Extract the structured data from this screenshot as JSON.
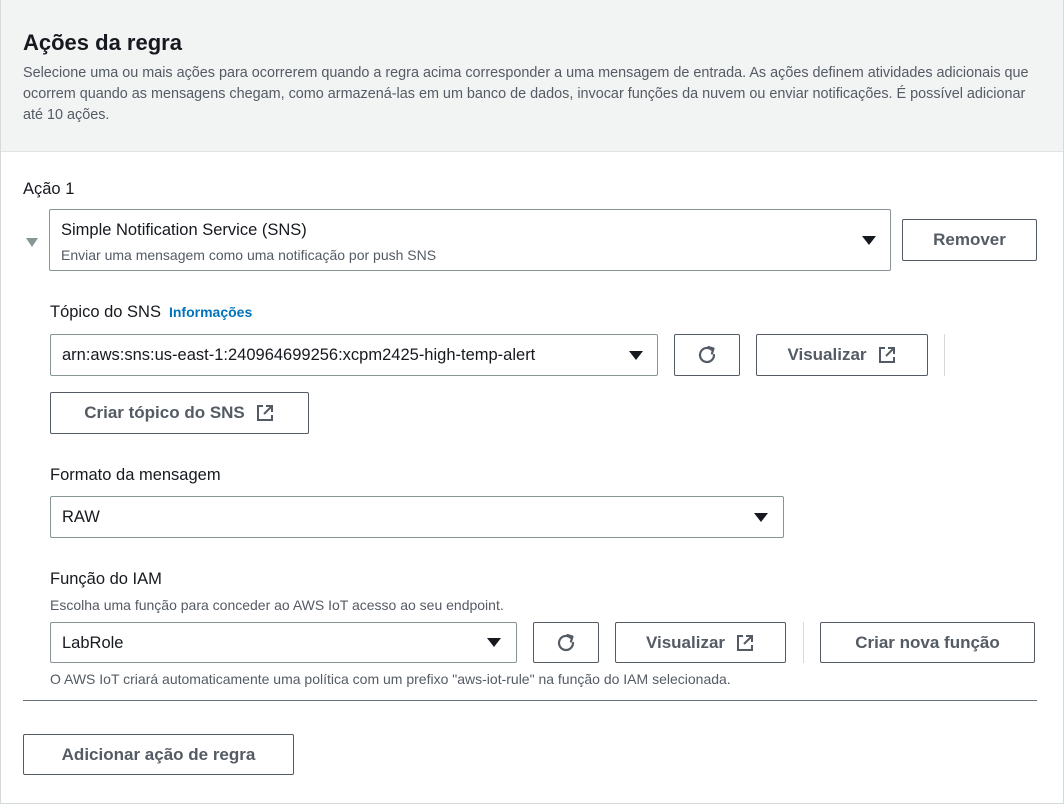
{
  "section": {
    "title": "Ações da regra",
    "description": "Selecione uma ou mais ações para ocorrerem quando a regra acima corresponder a uma mensagem de entrada. As ações definem atividades adicionais que ocorrem quando as mensagens chegam, como armazená-las em um banco de dados, invocar funções da nuvem ou enviar notificações. É possível adicionar até 10 ações."
  },
  "action": {
    "label": "Ação 1",
    "type_value": "Simple Notification Service (SNS)",
    "type_description": "Enviar uma mensagem como uma notificação por push SNS",
    "remove_label": "Remover"
  },
  "sns_topic": {
    "label": "Tópico do SNS",
    "info_label": "Informações",
    "value": "arn:aws:sns:us-east-1:240964699256:xcpm2425-high-temp-alert",
    "view_label": "Visualizar",
    "create_label": "Criar tópico do SNS"
  },
  "message_format": {
    "label": "Formato da mensagem",
    "value": "RAW"
  },
  "iam_role": {
    "label": "Função do IAM",
    "description": "Escolha uma função para conceder ao AWS IoT acesso ao seu endpoint.",
    "value": "LabRole",
    "view_label": "Visualizar",
    "create_label": "Criar nova função",
    "hint": "O AWS IoT criará automaticamente uma política com um prefixo \"aws-iot-rule\" na função do IAM selecionada."
  },
  "add_action_label": "Adicionar ação de regra",
  "icons": {
    "expand": "caret-down-icon",
    "dropdown": "caret-down-icon",
    "refresh": "refresh-icon",
    "external": "external-link-icon"
  },
  "colors": {
    "header_bg": "#f2f3f3",
    "link": "#0073bb",
    "text": "#16191f",
    "secondary_text": "#545b64",
    "border": "#879596"
  }
}
